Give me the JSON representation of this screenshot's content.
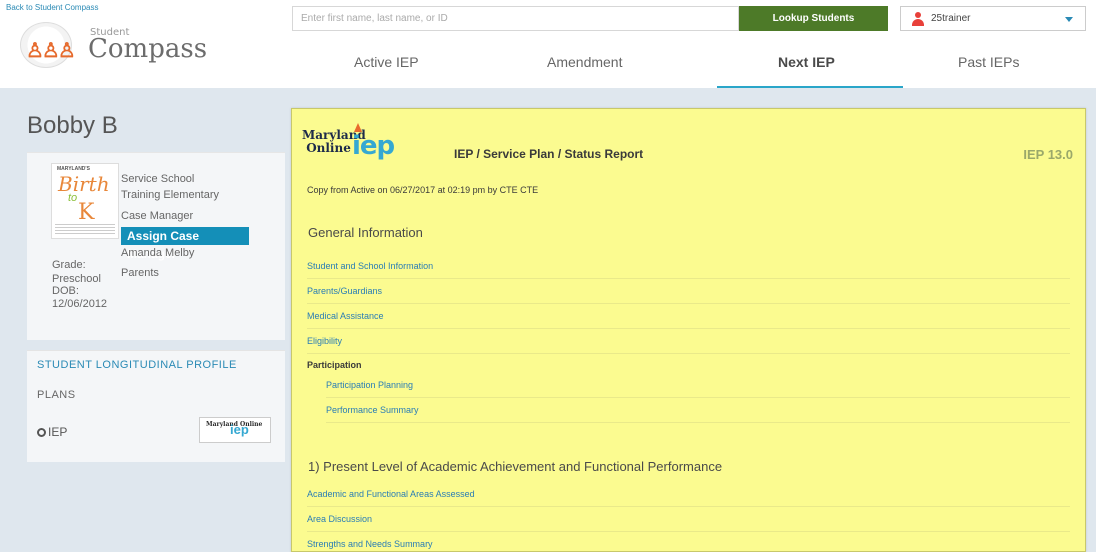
{
  "header": {
    "back_link": "Back to Student Compass",
    "logo_small": "Student",
    "logo_big": "Compass",
    "search_placeholder": "Enter first name, last name, or ID",
    "lookup_label": "Lookup Students",
    "user_name": "25trainer"
  },
  "tabs": [
    {
      "label": "Active IEP"
    },
    {
      "label": "Amendment"
    },
    {
      "label": "Next IEP"
    },
    {
      "label": "Past IEPs"
    }
  ],
  "student": {
    "name": "Bobby B",
    "btk_logo": {
      "line1": "MARYLAND'S",
      "line2": "Birth",
      "line3": "to",
      "line4": "K"
    },
    "service_school_label": "Service School",
    "service_school": "Training Elementary",
    "case_manager_label": "Case Manager",
    "assign_case_manager": "Assign Case Manager",
    "case_manager_name": "Amanda Melby",
    "parents_label": "Parents",
    "grade_label": "Grade:",
    "grade": "Preschool",
    "dob_label": "DOB:",
    "dob": "12/06/2012"
  },
  "longitudinal": {
    "title": "STUDENT LONGITUDINAL PROFILE",
    "plans": "PLANS",
    "iep": "IEP",
    "logo_text": "Maryland Online",
    "logo_iep": "iep"
  },
  "panel": {
    "logo_maryland": "Maryland",
    "logo_online": "Online",
    "logo_iep": "iep",
    "title": "IEP / Service Plan / Status Report",
    "version": "IEP 13.0",
    "copy_note": "Copy from Active on 06/27/2017 at 02:19 pm by CTE CTE",
    "general_info": "General Information",
    "general_items": [
      "Student and School Information",
      "Parents/Guardians",
      "Medical Assistance",
      "Eligibility",
      "Participation"
    ],
    "participation_items": [
      "Participation Planning",
      "Performance Summary"
    ],
    "plaafp_heading": "1) Present Level of Academic Achievement and Functional Performance",
    "plaafp_items": [
      "Academic and Functional Areas Assessed",
      "Area Discussion",
      "Strengths and Needs Summary"
    ]
  }
}
